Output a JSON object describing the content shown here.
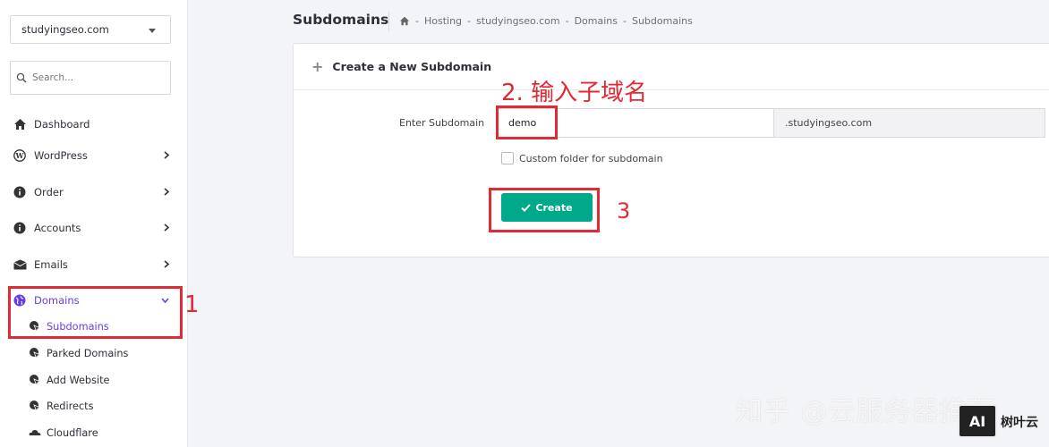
{
  "sidebar": {
    "domain_select": "studyingseo.com",
    "search_placeholder": "Search...",
    "nav": [
      {
        "label": "Dashboard"
      },
      {
        "label": "WordPress"
      },
      {
        "label": "Order"
      },
      {
        "label": "Accounts"
      },
      {
        "label": "Emails"
      },
      {
        "label": "Domains"
      }
    ],
    "domains_sub": [
      {
        "label": "Subdomains"
      },
      {
        "label": "Parked Domains"
      },
      {
        "label": "Add Website"
      },
      {
        "label": "Redirects"
      },
      {
        "label": "Cloudflare"
      }
    ]
  },
  "header": {
    "title": "Subdomains",
    "breadcrumb": [
      "Hosting",
      "studyingseo.com",
      "Domains",
      "Subdomains"
    ],
    "sep": "-"
  },
  "card": {
    "title": "Create a New Subdomain",
    "field_label": "Enter Subdomain",
    "subdomain_value": "demo",
    "suffix": ".studyingseo.com",
    "checkbox_label": "Custom folder for subdomain",
    "create_label": "Create"
  },
  "annotations": {
    "step1": "1",
    "step2": "2. 输入子域名",
    "step3": "3",
    "color": "#e02a35"
  },
  "watermark": {
    "text": "知乎 @云服务器推荐",
    "logo": "AI",
    "logo_text": "树叶云"
  },
  "colors": {
    "accent": "#673de6",
    "create": "#00a88a"
  }
}
